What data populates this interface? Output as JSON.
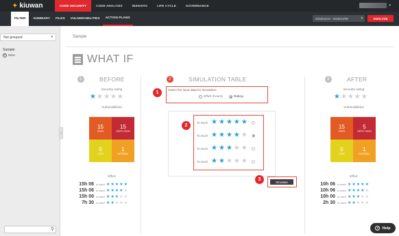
{
  "topbar": {
    "logo": "kiuwan",
    "nav": [
      "CODE SECURITY",
      "CODE ANALYSIS",
      "INSIGHTS",
      "LIFE CYCLE",
      "GOVERNANCE"
    ]
  },
  "subbar": {
    "tabs": [
      "FILTER",
      "SUMMARY",
      "FILES",
      "VULNERABILITIES",
      "ACTION PLANS"
    ],
    "date_range": "2018/11/10 - 2018/12/09",
    "analyze": "ANALYZE"
  },
  "sidebar": {
    "grouping": "Not grouped",
    "title": "Sample",
    "new_label": "New"
  },
  "breadcrumb": "Sample",
  "page_title": "WHAT IF",
  "before": {
    "num": "1",
    "title": "BEFORE",
    "security_label": "Security rating",
    "rating": 1,
    "vulns_label": "Vulnerabilities",
    "cells": [
      {
        "n": "15",
        "l": "HIGH"
      },
      {
        "n": "15",
        "l": "VERY HIGH"
      },
      {
        "n": "0",
        "l": "LOW"
      },
      {
        "n": "1",
        "l": "NORMAL"
      }
    ],
    "effort_label": "Effort",
    "efforts": [
      {
        "h": "15h 06",
        "tr": "to reach",
        "stars": 5
      },
      {
        "h": "15h 06",
        "tr": "to reach",
        "stars": 4
      },
      {
        "h": "15h 00",
        "tr": "to reach",
        "stars": 3
      },
      {
        "h": "7h 30",
        "tr": "to reach",
        "stars": 2
      }
    ]
  },
  "sim": {
    "num": "2",
    "title": "SIMULATION TABLE",
    "question": "Select the input data for simulation:",
    "opt_effort": "Effort (hours)",
    "opt_rating": "Rating",
    "to_reach": "To reach",
    "rows": [
      5,
      4,
      3,
      2
    ],
    "selected_row": 1,
    "simulate": "Simulate"
  },
  "after": {
    "num": "3",
    "title": "AFTER",
    "security_label": "Security rating",
    "rating": 1,
    "vulns_label": "Vulnerabilities",
    "cells": [
      {
        "n": "15",
        "l": "HIGH"
      },
      {
        "n": "5",
        "l": "VERY HIGH"
      },
      {
        "n": "0",
        "l": "LOW"
      },
      {
        "n": "1",
        "l": "NORMAL"
      }
    ],
    "effort_label": "Effort",
    "efforts": [
      {
        "h": "10h 06",
        "tr": "to reach",
        "stars": 5
      },
      {
        "h": "10h 06",
        "tr": "to reach",
        "stars": 4
      },
      {
        "h": "10h 00",
        "tr": "to reach",
        "stars": 3
      },
      {
        "h": "2h 30",
        "tr": "to reach",
        "stars": 2
      }
    ]
  },
  "callouts": [
    "1",
    "2",
    "3"
  ],
  "help": "Help",
  "colors": {
    "accent": "#e2282f",
    "star": "#2c9fd7"
  }
}
